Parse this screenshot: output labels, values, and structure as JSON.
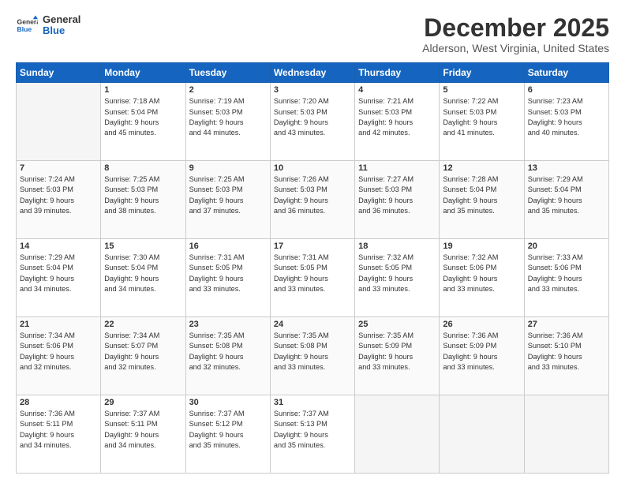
{
  "header": {
    "logo_line1": "General",
    "logo_line2": "Blue",
    "title": "December 2025",
    "subtitle": "Alderson, West Virginia, United States"
  },
  "weekdays": [
    "Sunday",
    "Monday",
    "Tuesday",
    "Wednesday",
    "Thursday",
    "Friday",
    "Saturday"
  ],
  "weeks": [
    [
      {
        "day": "",
        "info": ""
      },
      {
        "day": "1",
        "info": "Sunrise: 7:18 AM\nSunset: 5:04 PM\nDaylight: 9 hours\nand 45 minutes."
      },
      {
        "day": "2",
        "info": "Sunrise: 7:19 AM\nSunset: 5:03 PM\nDaylight: 9 hours\nand 44 minutes."
      },
      {
        "day": "3",
        "info": "Sunrise: 7:20 AM\nSunset: 5:03 PM\nDaylight: 9 hours\nand 43 minutes."
      },
      {
        "day": "4",
        "info": "Sunrise: 7:21 AM\nSunset: 5:03 PM\nDaylight: 9 hours\nand 42 minutes."
      },
      {
        "day": "5",
        "info": "Sunrise: 7:22 AM\nSunset: 5:03 PM\nDaylight: 9 hours\nand 41 minutes."
      },
      {
        "day": "6",
        "info": "Sunrise: 7:23 AM\nSunset: 5:03 PM\nDaylight: 9 hours\nand 40 minutes."
      }
    ],
    [
      {
        "day": "7",
        "info": "Sunrise: 7:24 AM\nSunset: 5:03 PM\nDaylight: 9 hours\nand 39 minutes."
      },
      {
        "day": "8",
        "info": "Sunrise: 7:25 AM\nSunset: 5:03 PM\nDaylight: 9 hours\nand 38 minutes."
      },
      {
        "day": "9",
        "info": "Sunrise: 7:25 AM\nSunset: 5:03 PM\nDaylight: 9 hours\nand 37 minutes."
      },
      {
        "day": "10",
        "info": "Sunrise: 7:26 AM\nSunset: 5:03 PM\nDaylight: 9 hours\nand 36 minutes."
      },
      {
        "day": "11",
        "info": "Sunrise: 7:27 AM\nSunset: 5:03 PM\nDaylight: 9 hours\nand 36 minutes."
      },
      {
        "day": "12",
        "info": "Sunrise: 7:28 AM\nSunset: 5:04 PM\nDaylight: 9 hours\nand 35 minutes."
      },
      {
        "day": "13",
        "info": "Sunrise: 7:29 AM\nSunset: 5:04 PM\nDaylight: 9 hours\nand 35 minutes."
      }
    ],
    [
      {
        "day": "14",
        "info": "Sunrise: 7:29 AM\nSunset: 5:04 PM\nDaylight: 9 hours\nand 34 minutes."
      },
      {
        "day": "15",
        "info": "Sunrise: 7:30 AM\nSunset: 5:04 PM\nDaylight: 9 hours\nand 34 minutes."
      },
      {
        "day": "16",
        "info": "Sunrise: 7:31 AM\nSunset: 5:05 PM\nDaylight: 9 hours\nand 33 minutes."
      },
      {
        "day": "17",
        "info": "Sunrise: 7:31 AM\nSunset: 5:05 PM\nDaylight: 9 hours\nand 33 minutes."
      },
      {
        "day": "18",
        "info": "Sunrise: 7:32 AM\nSunset: 5:05 PM\nDaylight: 9 hours\nand 33 minutes."
      },
      {
        "day": "19",
        "info": "Sunrise: 7:32 AM\nSunset: 5:06 PM\nDaylight: 9 hours\nand 33 minutes."
      },
      {
        "day": "20",
        "info": "Sunrise: 7:33 AM\nSunset: 5:06 PM\nDaylight: 9 hours\nand 33 minutes."
      }
    ],
    [
      {
        "day": "21",
        "info": "Sunrise: 7:34 AM\nSunset: 5:06 PM\nDaylight: 9 hours\nand 32 minutes."
      },
      {
        "day": "22",
        "info": "Sunrise: 7:34 AM\nSunset: 5:07 PM\nDaylight: 9 hours\nand 32 minutes."
      },
      {
        "day": "23",
        "info": "Sunrise: 7:35 AM\nSunset: 5:08 PM\nDaylight: 9 hours\nand 32 minutes."
      },
      {
        "day": "24",
        "info": "Sunrise: 7:35 AM\nSunset: 5:08 PM\nDaylight: 9 hours\nand 33 minutes."
      },
      {
        "day": "25",
        "info": "Sunrise: 7:35 AM\nSunset: 5:09 PM\nDaylight: 9 hours\nand 33 minutes."
      },
      {
        "day": "26",
        "info": "Sunrise: 7:36 AM\nSunset: 5:09 PM\nDaylight: 9 hours\nand 33 minutes."
      },
      {
        "day": "27",
        "info": "Sunrise: 7:36 AM\nSunset: 5:10 PM\nDaylight: 9 hours\nand 33 minutes."
      }
    ],
    [
      {
        "day": "28",
        "info": "Sunrise: 7:36 AM\nSunset: 5:11 PM\nDaylight: 9 hours\nand 34 minutes."
      },
      {
        "day": "29",
        "info": "Sunrise: 7:37 AM\nSunset: 5:11 PM\nDaylight: 9 hours\nand 34 minutes."
      },
      {
        "day": "30",
        "info": "Sunrise: 7:37 AM\nSunset: 5:12 PM\nDaylight: 9 hours\nand 35 minutes."
      },
      {
        "day": "31",
        "info": "Sunrise: 7:37 AM\nSunset: 5:13 PM\nDaylight: 9 hours\nand 35 minutes."
      },
      {
        "day": "",
        "info": ""
      },
      {
        "day": "",
        "info": ""
      },
      {
        "day": "",
        "info": ""
      }
    ]
  ]
}
